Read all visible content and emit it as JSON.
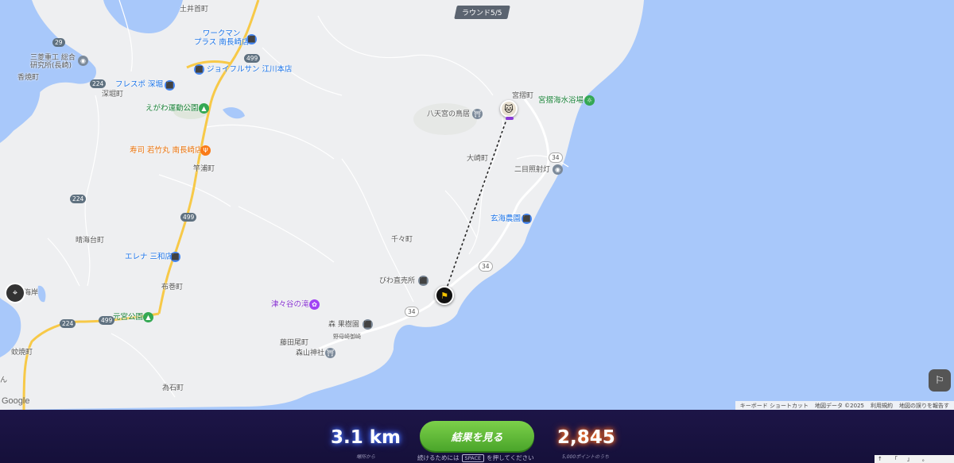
{
  "round_badge": "ラウンド5/5",
  "map": {
    "colors": {
      "sea": "#a8c8fa",
      "land": "#eeeff1",
      "road_major": "#f7c948",
      "road_minor": "#ffffff"
    },
    "labels": {
      "tsuchii": "土井首町",
      "workman": "ワークマン\nプラス 南長崎店",
      "joyful": "ジョイフルサン 江川本店",
      "mitsubishi": "三菱重工 総合\n研究所(長崎)",
      "kouyaki": "香焼町",
      "fresco": "フレスポ 深堀",
      "fukahori": "深堀町",
      "egawa_park": "えがわ運動公園",
      "sushi": "寿司 若竹丸 南長崎店",
      "sasaura": "竿浦町",
      "hareumi": "晴海台町",
      "elena": "エレナ 三和店",
      "nunomaki": "布巻町",
      "motomiya": "元宮公園",
      "monsaki": "蚊焼町",
      "tameishi": "為石町",
      "miyazuri": "宮摺町",
      "hachiman": "八天宮の鳥居",
      "miyazuri_beach": "宮摺海水浴場",
      "osaki": "大崎町",
      "lighthouse": "二目照射灯",
      "genkai": "玄海農園",
      "chiji": "千々町",
      "biwa": "びわ直売所",
      "tsutsuya": "津々谷の滝",
      "mori_orchard": "森 果樹園",
      "fujitao": "藤田尾町",
      "moriyama": "森山神社",
      "biwa_road": "野母崎御崎",
      "cut_left": "海岸",
      "cut_left2": "ん"
    },
    "shields": {
      "r29": "29",
      "r224a": "224",
      "r224b": "224",
      "r224c": "224",
      "r499a": "499",
      "r499b": "499",
      "r499c": "499",
      "r34a": "34",
      "r34b": "34",
      "r34c": "34"
    },
    "google": "Google",
    "attribution": {
      "shortcuts": "キーボード ショートカット",
      "mapdata": "地図データ ©2025",
      "terms": "利用規約",
      "report": "地図の誤りを報告す"
    }
  },
  "result": {
    "distance": "3.1 km",
    "distance_sub": "場所から",
    "button": "結果を見る",
    "hint_pre": "続けるためには",
    "hint_key": "SPACE",
    "hint_post": "を押してください",
    "points": "2,845",
    "points_sub": "5,000ポイントのうち"
  },
  "mini_keys": [
    "↑",
    "「",
    "」",
    "。"
  ]
}
